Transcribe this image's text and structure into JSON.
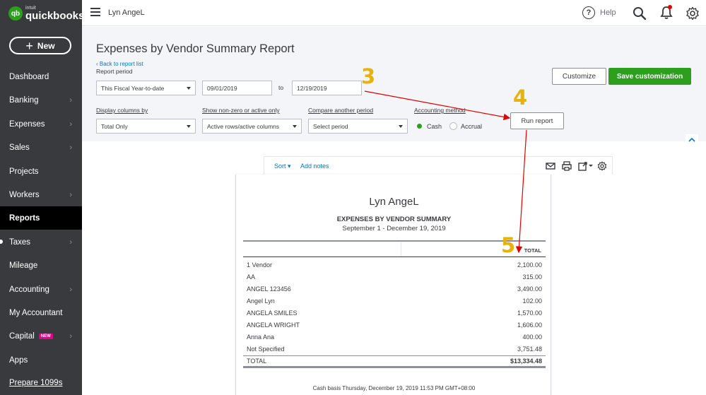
{
  "brand": {
    "intuit": "intuit",
    "name": "quickbooks",
    "badge": "qb",
    "accent": "#2ca01c"
  },
  "sidebar": {
    "new_button": "New",
    "items": [
      {
        "label": "Dashboard",
        "chevron": false
      },
      {
        "label": "Banking",
        "chevron": true
      },
      {
        "label": "Expenses",
        "chevron": true
      },
      {
        "label": "Sales",
        "chevron": true
      },
      {
        "label": "Projects",
        "chevron": false
      },
      {
        "label": "Workers",
        "chevron": true
      },
      {
        "label": "Reports",
        "chevron": false,
        "active": true
      },
      {
        "label": "Taxes",
        "chevron": true
      },
      {
        "label": "Mileage",
        "chevron": false
      },
      {
        "label": "Accounting",
        "chevron": true
      },
      {
        "label": "My Accountant",
        "chevron": false
      },
      {
        "label": "Capital",
        "chevron": true,
        "badge": "NEW"
      },
      {
        "label": "Apps",
        "chevron": false
      },
      {
        "label": "Prepare 1099s",
        "chevron": false,
        "link": true
      }
    ]
  },
  "topbar": {
    "company": "Lyn AngeL",
    "help": "Help",
    "help_glyph": "?"
  },
  "settings": {
    "title": "Expenses by Vendor Summary Report",
    "back_link": "Back to report list",
    "report_period_label": "Report period",
    "report_period_value": "This Fiscal Year-to-date",
    "date_from": "09/01/2019",
    "to_label": "to",
    "date_to": "12/19/2019",
    "display_columns_label": "Display columns by",
    "display_columns_value": "Total Only",
    "show_nonzero_label": "Show non-zero or active only",
    "show_nonzero_value": "Active rows/active columns",
    "compare_label": "Compare another period",
    "compare_value": "Select period",
    "accounting_method_label": "Accounting method",
    "cash_label": "Cash",
    "accrual_label": "Accrual",
    "run_report": "Run report",
    "customize": "Customize",
    "save_customization": "Save customization"
  },
  "report_toolbar": {
    "sort": "Sort",
    "add_notes": "Add notes"
  },
  "report": {
    "company": "Lyn AngeL",
    "title": "EXPENSES BY VENDOR SUMMARY",
    "date_range": "September 1 - December 19, 2019",
    "total_header": "TOTAL",
    "rows": [
      {
        "name": "1 Vendor",
        "amount": "2,100.00"
      },
      {
        "name": "AA",
        "amount": "315.00"
      },
      {
        "name": "ANGEL 123456",
        "amount": "3,490.00"
      },
      {
        "name": "Angel Lyn",
        "amount": "102.00"
      },
      {
        "name": "ANGELA SMILES",
        "amount": "1,570.00"
      },
      {
        "name": "ANGELA WRIGHT",
        "amount": "1,606.00"
      },
      {
        "name": "Anna Ana",
        "amount": "400.00"
      },
      {
        "name": "Not Specified",
        "amount": "3,751.48"
      }
    ],
    "total_label": "TOTAL",
    "total_amount": "$13,334.48",
    "footer": "Cash basis  Thursday, December 19, 2019  11:53 PM GMT+08:00"
  },
  "annotations": {
    "step3": "3",
    "step4": "4",
    "step5": "5",
    "color": "#e8b10b",
    "arrow_color": "#e00000"
  }
}
